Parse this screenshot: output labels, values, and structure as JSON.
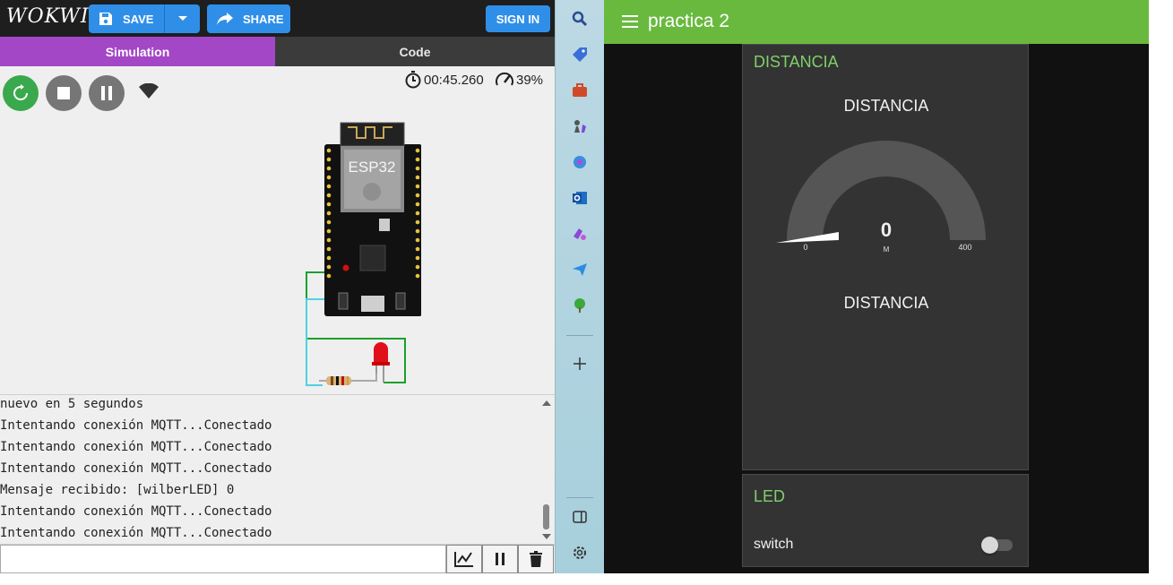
{
  "wokwi": {
    "logo": "WOKWI",
    "save_label": "SAVE",
    "share_label": "SHARE",
    "signin_label": "SIGN IN",
    "tabs": [
      {
        "label": "Simulation",
        "active": true
      },
      {
        "label": "Code",
        "active": false
      }
    ],
    "sim": {
      "timer": "00:45.260",
      "speed": "39%",
      "board_label": "ESP32"
    },
    "serial_lines": [
      "nuevo en 5 segundos",
      "Intentando conexión MQTT...Conectado",
      "Intentando conexión MQTT...Conectado",
      "Intentando conexión MQTT...Conectado",
      "Mensaje recibido: [wilberLED] 0",
      "Intentando conexión MQTT...Conectado",
      "Intentando conexión MQTT...Conectado"
    ],
    "serial_input_value": ""
  },
  "sidebar_icons": [
    "search-icon",
    "tag-icon",
    "toolbox-icon",
    "chess-icon",
    "copilot-icon",
    "outlook-icon",
    "games-icon",
    "send-icon",
    "tree-icon",
    "add-icon",
    "split-view-icon",
    "settings-icon"
  ],
  "dashboard": {
    "title": "practica 2",
    "group1": {
      "title": "DISTANCIA",
      "gauge_title": "DISTANCIA",
      "gauge_label": "DISTANCIA",
      "value": "0",
      "units": "M",
      "min": "0",
      "max": "400"
    },
    "group2": {
      "title": "LED",
      "switch_label": "switch",
      "switch_on": false
    },
    "colors": {
      "header": "#6ab93f",
      "group_title": "#7fd06a",
      "card": "#333333"
    }
  }
}
